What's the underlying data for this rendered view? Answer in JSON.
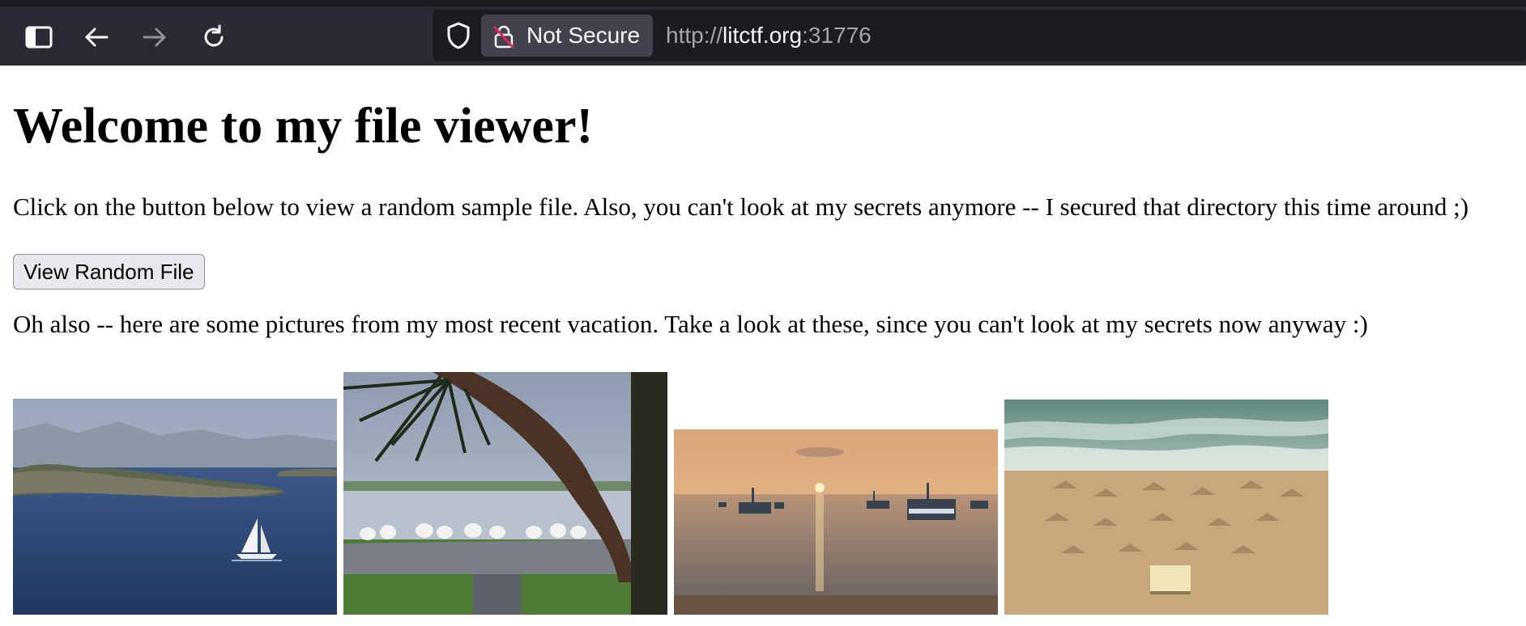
{
  "browser": {
    "security_label": "Not Secure",
    "url_scheme": "http://",
    "url_host": "litctf.org",
    "url_port": ":31776",
    "icons": [
      "sidebar-icon",
      "back-arrow-icon",
      "forward-arrow-icon",
      "reload-icon",
      "shield-icon",
      "insecure-lock-icon"
    ]
  },
  "page": {
    "heading": "Welcome to my file viewer!",
    "intro": "Click on the button below to view a random sample file. Also, you can't look at my secrets anymore -- I secured that directory this time around ;)",
    "button_label": "View Random File",
    "vacation_text": "Oh also -- here are some pictures from my most recent vacation. Take a look at these, since you can't look at my secrets now anyway :)"
  },
  "photos": [
    {
      "name": "sailboat-island-photo"
    },
    {
      "name": "seagulls-palm-photo"
    },
    {
      "name": "sunset-boats-photo"
    },
    {
      "name": "beach-umbrellas-photo"
    }
  ],
  "colors": {
    "toolbar": "#2b2a33",
    "urlbar": "#1c1b22",
    "button_bg": "#e9e9ed"
  }
}
